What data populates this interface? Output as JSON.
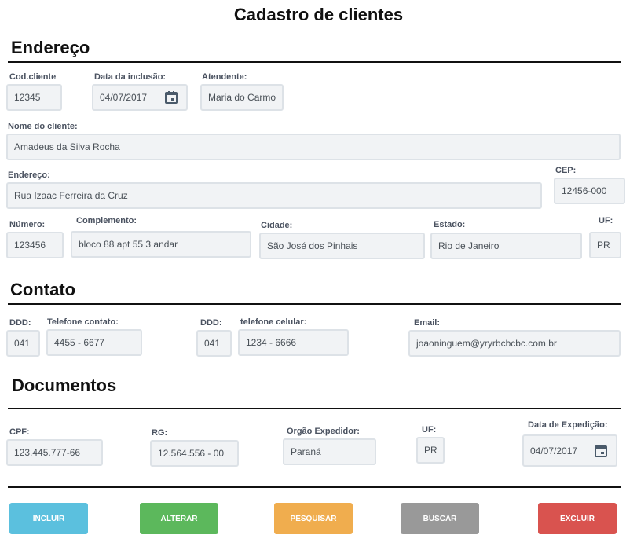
{
  "page_title": "Cadastro de clientes",
  "sections": {
    "endereco": "Endereço",
    "contato": "Contato",
    "documentos": "Documentos"
  },
  "endereco": {
    "cod_cliente": {
      "label": "Cod.cliente",
      "value": "12345"
    },
    "data_inclusao": {
      "label": "Data da inclusão:",
      "value": "04/07/2017"
    },
    "atendente": {
      "label": "Atendente:",
      "value": "Maria do Carmo"
    },
    "nome": {
      "label": "Nome do cliente:",
      "value": "Amadeus da Silva Rocha"
    },
    "endereco": {
      "label": "Endereço:",
      "value": "Rua Izaac Ferreira da Cruz"
    },
    "cep": {
      "label": "CEP:",
      "value": "12456-000"
    },
    "numero": {
      "label": "Número:",
      "value": "123456"
    },
    "complemento": {
      "label": "Complemento:",
      "value": "bloco 88 apt 55 3 andar"
    },
    "cidade": {
      "label": "Cidade:",
      "value": "São José dos Pinhais"
    },
    "estado": {
      "label": "Estado:",
      "value": "Rio de Janeiro"
    },
    "uf": {
      "label": "UF:",
      "value": "PR"
    }
  },
  "contato": {
    "ddd1": {
      "label": "DDD:",
      "value": "041"
    },
    "telefone": {
      "label": "Telefone contato:",
      "value": "4455 - 6677"
    },
    "ddd2": {
      "label": "DDD:",
      "value": "041"
    },
    "celular": {
      "label": "telefone celular:",
      "value": "1234 - 6666"
    },
    "email": {
      "label": "Email:",
      "value": "joaoninguem@yryrbcbcbc.com.br"
    }
  },
  "documentos": {
    "cpf": {
      "label": "CPF:",
      "value": "123.445.777-66"
    },
    "rg": {
      "label": "RG:",
      "value": "12.564.556 - 00"
    },
    "orgao": {
      "label": "Orgão Expedidor:",
      "value": "Paraná"
    },
    "uf": {
      "label": "UF:",
      "value": "PR"
    },
    "data_expedicao": {
      "label": "Data de Expedição:",
      "value": "04/07/2017"
    }
  },
  "buttons": {
    "incluir": {
      "label": "INCLUIR",
      "color": "#5bc0de"
    },
    "alterar": {
      "label": "ALTERAR",
      "color": "#5cb85c"
    },
    "pesquisar": {
      "label": "PESQUISAR",
      "color": "#f0ad4e"
    },
    "buscar": {
      "label": "BUSCAR",
      "color": "#999999"
    },
    "excluir": {
      "label": "EXCLUIR",
      "color": "#d9534f"
    }
  },
  "icons": {
    "calendar": "calendar-icon"
  }
}
